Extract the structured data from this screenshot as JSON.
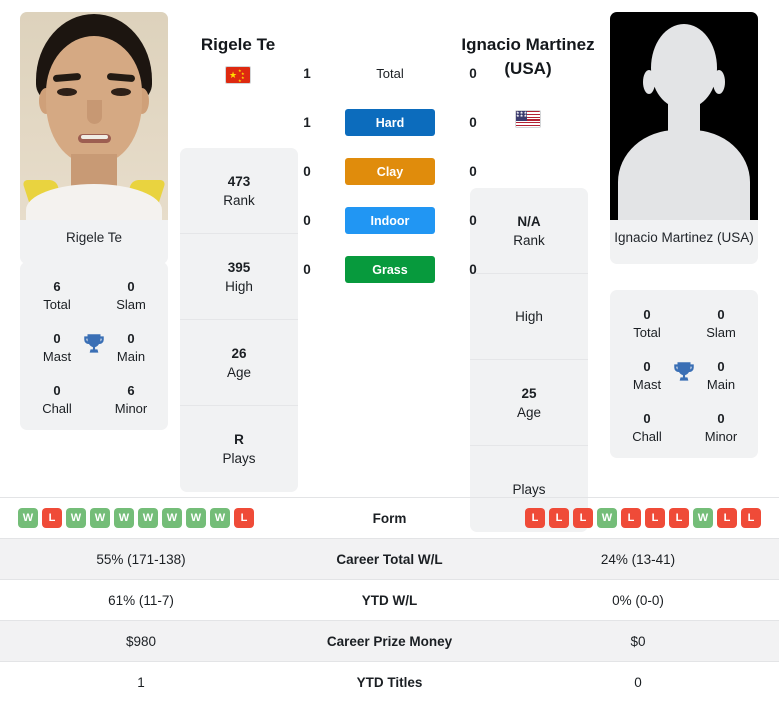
{
  "players": {
    "left": {
      "name": "Rigele Te",
      "caption": "Rigele Te",
      "flag": "china-flag",
      "rank": "473",
      "rank_label": "Rank",
      "high": "395",
      "high_label": "High",
      "age": "26",
      "age_label": "Age",
      "plays": "R",
      "plays_label": "Plays",
      "titles": {
        "total": "6",
        "total_label": "Total",
        "slam": "0",
        "slam_label": "Slam",
        "mast": "0",
        "mast_label": "Mast",
        "main": "0",
        "main_label": "Main",
        "chall": "0",
        "chall_label": "Chall",
        "minor": "6",
        "minor_label": "Minor"
      }
    },
    "right": {
      "name": "Ignacio Martinez (USA)",
      "caption": "Ignacio Martinez (USA)",
      "flag": "usa-flag",
      "rank": "N/A",
      "rank_label": "Rank",
      "high": "",
      "high_label": "High",
      "age": "25",
      "age_label": "Age",
      "plays": "",
      "plays_label": "Plays",
      "titles": {
        "total": "0",
        "total_label": "Total",
        "slam": "0",
        "slam_label": "Slam",
        "mast": "0",
        "mast_label": "Mast",
        "main": "0",
        "main_label": "Main",
        "chall": "0",
        "chall_label": "Chall",
        "minor": "0",
        "minor_label": "Minor"
      }
    }
  },
  "head_to_head": {
    "rows": [
      {
        "label": "Total",
        "left": "1",
        "right": "0",
        "color": ""
      },
      {
        "label": "Hard",
        "left": "1",
        "right": "0",
        "color": "#0c6cbd"
      },
      {
        "label": "Clay",
        "left": "0",
        "right": "0",
        "color": "#e08c0c"
      },
      {
        "label": "Indoor",
        "left": "0",
        "right": "0",
        "color": "#2196f3"
      },
      {
        "label": "Grass",
        "left": "0",
        "right": "0",
        "color": "#079a3d"
      }
    ]
  },
  "comparison_table": {
    "form_label": "Form",
    "left_form": [
      "W",
      "L",
      "W",
      "W",
      "W",
      "W",
      "W",
      "W",
      "W",
      "L"
    ],
    "right_form": [
      "L",
      "L",
      "L",
      "W",
      "L",
      "L",
      "L",
      "W",
      "L",
      "L"
    ],
    "rows": [
      {
        "label": "Career Total W/L",
        "left": "55% (171-138)",
        "right": "24% (13-41)"
      },
      {
        "label": "YTD W/L",
        "left": "61% (11-7)",
        "right": "0% (0-0)"
      },
      {
        "label": "Career Prize Money",
        "left": "$980",
        "right": "$0"
      },
      {
        "label": "YTD Titles",
        "left": "1",
        "right": "0"
      }
    ]
  },
  "colors": {
    "win": "#74bd78",
    "loss": "#ef4b38",
    "card_bg": "#f1f2f3",
    "row_shade": "#f2f2f3"
  }
}
